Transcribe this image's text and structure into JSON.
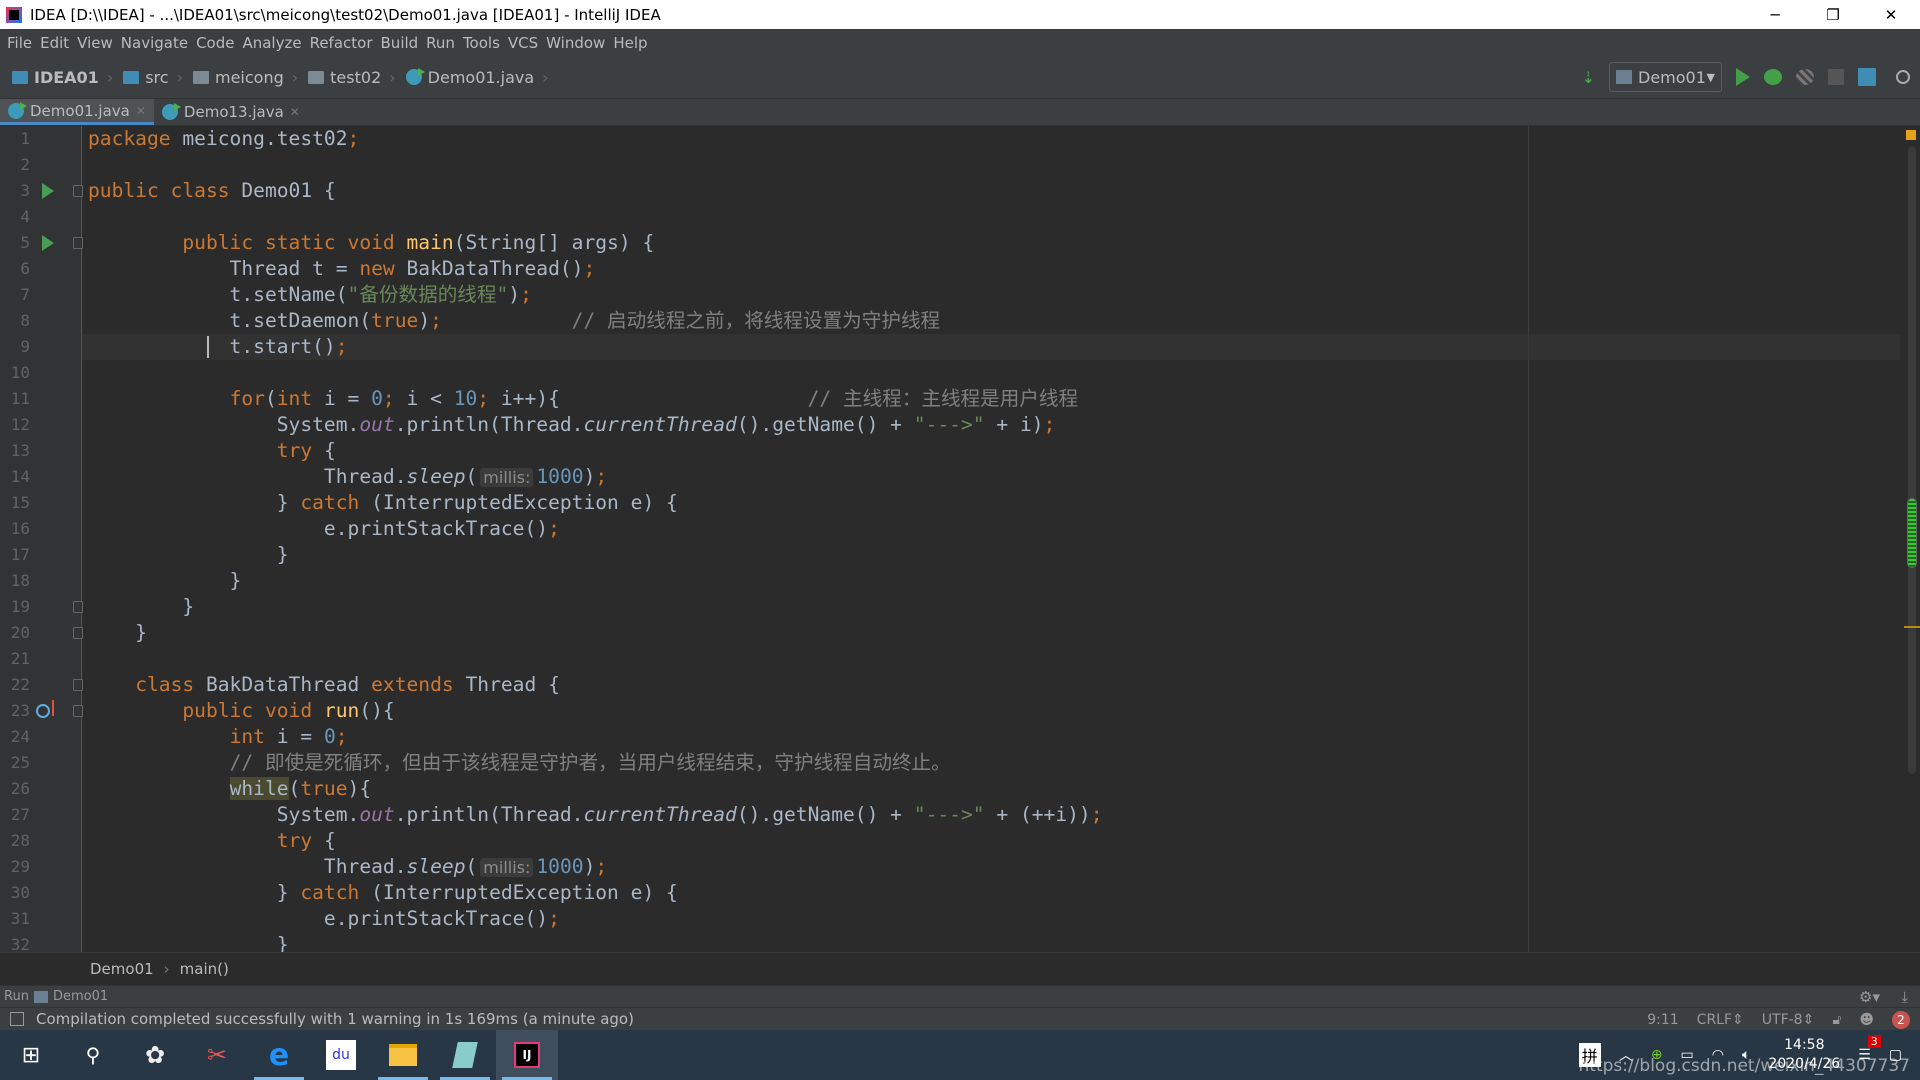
{
  "window": {
    "title": "IDEA [D:\\\\IDEA] - ...\\IDEA01\\src\\meicong\\test02\\Demo01.java [IDEA01] - IntelliJ IDEA",
    "minimize": "─",
    "restore": "❐",
    "close": "✕"
  },
  "menu": [
    "File",
    "Edit",
    "View",
    "Navigate",
    "Code",
    "Analyze",
    "Refactor",
    "Build",
    "Run",
    "Tools",
    "VCS",
    "Window",
    "Help"
  ],
  "nav": {
    "crumbs": [
      "IDEA01",
      "src",
      "meicong",
      "test02",
      "Demo01.java"
    ],
    "run_config": "Demo01"
  },
  "tabs": [
    {
      "label": "Demo01.java",
      "active": true
    },
    {
      "label": "Demo13.java",
      "active": false
    }
  ],
  "editor": {
    "current_line": 9,
    "lines": [
      [
        [
          "kw",
          "package "
        ],
        [
          "pl",
          "meicong.test02"
        ],
        [
          "kw",
          ";"
        ]
      ],
      [],
      [
        [
          "kw",
          "public class "
        ],
        [
          "pl",
          "Demo01 {"
        ]
      ],
      [],
      [
        [
          "pl",
          "        "
        ],
        [
          "kw",
          "public static void "
        ],
        [
          "fn",
          "main"
        ],
        [
          "pl",
          "(String[] args) {"
        ]
      ],
      [
        [
          "pl",
          "            Thread t = "
        ],
        [
          "kw",
          "new "
        ],
        [
          "pl",
          "BakDataThread()"
        ],
        [
          "kw",
          ";"
        ]
      ],
      [
        [
          "pl",
          "            t.setName("
        ],
        [
          "str",
          "\"备份数据的线程\""
        ],
        [
          "pl",
          ")"
        ],
        [
          "kw",
          ";"
        ]
      ],
      [
        [
          "pl",
          "            t.setDaemon("
        ],
        [
          "kw",
          "true"
        ],
        [
          "pl",
          ")"
        ],
        [
          "kw",
          ";"
        ],
        [
          "pl",
          "           "
        ],
        [
          "cm",
          "// 启动线程之前，将线程设置为守护线程"
        ]
      ],
      [
        [
          "pl",
          "            t.start()"
        ],
        [
          "kw",
          ";"
        ]
      ],
      [],
      [
        [
          "pl",
          "            "
        ],
        [
          "kw",
          "for"
        ],
        [
          "pl",
          "("
        ],
        [
          "kw",
          "int "
        ],
        [
          "pl",
          "i = "
        ],
        [
          "num",
          "0"
        ],
        [
          "kw",
          "; "
        ],
        [
          "pl",
          "i < "
        ],
        [
          "num",
          "10"
        ],
        [
          "kw",
          "; "
        ],
        [
          "pl",
          "i++){                     "
        ],
        [
          "cm",
          "// 主线程：主线程是用户线程"
        ]
      ],
      [
        [
          "pl",
          "                System."
        ],
        [
          "st",
          "out"
        ],
        [
          "pl",
          ".println(Thread."
        ],
        [
          "it",
          "currentThread"
        ],
        [
          "pl",
          "().getName() + "
        ],
        [
          "str",
          "\"--->\""
        ],
        [
          "pl",
          " + i)"
        ],
        [
          "kw",
          ";"
        ]
      ],
      [
        [
          "pl",
          "                "
        ],
        [
          "kw",
          "try "
        ],
        [
          "pl",
          "{"
        ]
      ],
      [
        [
          "pl",
          "                    Thread."
        ],
        [
          "it",
          "sleep"
        ],
        [
          "pl",
          "("
        ],
        [
          "hint",
          "millis:"
        ],
        [
          "num",
          "1000"
        ],
        [
          "pl",
          ")"
        ],
        [
          "kw",
          ";"
        ]
      ],
      [
        [
          "pl",
          "                } "
        ],
        [
          "kw",
          "catch "
        ],
        [
          "pl",
          "(InterruptedException e) {"
        ]
      ],
      [
        [
          "pl",
          "                    e.printStackTrace()"
        ],
        [
          "kw",
          ";"
        ]
      ],
      [
        [
          "pl",
          "                }"
        ]
      ],
      [
        [
          "pl",
          "            }"
        ]
      ],
      [
        [
          "pl",
          "        }"
        ]
      ],
      [
        [
          "pl",
          "    }"
        ]
      ],
      [],
      [
        [
          "pl",
          "    "
        ],
        [
          "kw",
          "class "
        ],
        [
          "pl",
          "BakDataThread "
        ],
        [
          "kw",
          "extends "
        ],
        [
          "pl",
          "Thread {"
        ]
      ],
      [
        [
          "pl",
          "        "
        ],
        [
          "kw",
          "public void "
        ],
        [
          "fn",
          "run"
        ],
        [
          "pl",
          "(){"
        ]
      ],
      [
        [
          "pl",
          "            "
        ],
        [
          "kw",
          "int "
        ],
        [
          "pl",
          "i = "
        ],
        [
          "num",
          "0"
        ],
        [
          "kw",
          ";"
        ]
      ],
      [
        [
          "pl",
          "            "
        ],
        [
          "cm",
          "// 即使是死循环，但由于该线程是守护者，当用户线程结束，守护线程自动终止。"
        ]
      ],
      [
        [
          "pl",
          "            "
        ],
        [
          "hl",
          "while"
        ],
        [
          "pl",
          "("
        ],
        [
          "kw",
          "true"
        ],
        [
          "pl",
          "){"
        ]
      ],
      [
        [
          "pl",
          "                System."
        ],
        [
          "st",
          "out"
        ],
        [
          "pl",
          ".println(Thread."
        ],
        [
          "it",
          "currentThread"
        ],
        [
          "pl",
          "().getName() + "
        ],
        [
          "str",
          "\"--->\""
        ],
        [
          "pl",
          " + (++i))"
        ],
        [
          "kw",
          ";"
        ]
      ],
      [
        [
          "pl",
          "                "
        ],
        [
          "kw",
          "try "
        ],
        [
          "pl",
          "{"
        ]
      ],
      [
        [
          "pl",
          "                    Thread."
        ],
        [
          "it",
          "sleep"
        ],
        [
          "pl",
          "("
        ],
        [
          "hint",
          "millis:"
        ],
        [
          "num",
          "1000"
        ],
        [
          "pl",
          ")"
        ],
        [
          "kw",
          ";"
        ]
      ],
      [
        [
          "pl",
          "                } "
        ],
        [
          "kw",
          "catch "
        ],
        [
          "pl",
          "(InterruptedException e) {"
        ]
      ],
      [
        [
          "pl",
          "                    e.printStackTrace()"
        ],
        [
          "kw",
          ";"
        ]
      ],
      [
        [
          "pl",
          "                }"
        ]
      ]
    ]
  },
  "breadcrumb": {
    "class": "Demo01",
    "method": "main()",
    "sep": "›"
  },
  "run_bar": {
    "label": "Run",
    "config": "Demo01"
  },
  "status": {
    "message": "Compilation completed successfully with 1 warning in 1s 169ms (a minute ago)",
    "position": "9:11",
    "line_sep": "CRLF⇕",
    "encoding": "UTF-8⇕",
    "notifications": "2"
  },
  "taskbar": {
    "ime": "拼",
    "time": "14:58",
    "date": "2020/4/26",
    "action_center_count": "3",
    "watermark": "https://blog.csdn.net/weixin_44307737"
  },
  "colors": {
    "keyword": "#cc7832",
    "string": "#6a8759",
    "number": "#6897bb",
    "comment": "#808080",
    "function": "#ffc66d",
    "static_field": "#9876aa",
    "text": "#a9b7c6",
    "editor_bg": "#2b2b2b"
  }
}
